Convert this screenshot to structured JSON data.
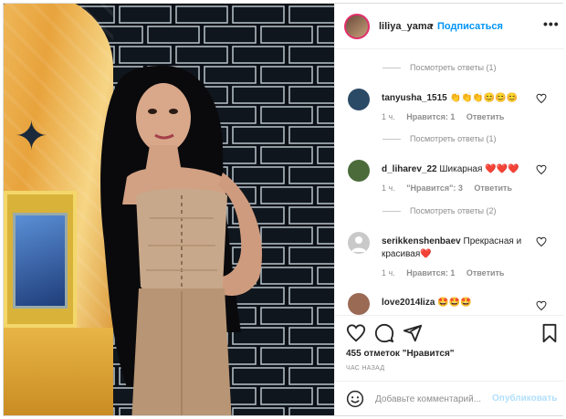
{
  "post": {
    "username": "liliya_yama",
    "separator": "•",
    "follow_label": "Подписаться",
    "more_label": "•••"
  },
  "comments": {
    "view_replies": [
      "Посмотреть ответы (1)",
      "Посмотреть ответы (1)",
      "Посмотреть ответы (2)"
    ],
    "items": [
      {
        "username": "tanyusha_1515",
        "text": "👏👏👏😊😊😊",
        "time": "1 ч.",
        "likes_label": "Нравится: 1",
        "reply_label": "Ответить",
        "avatar_color": "#2b4a66"
      },
      {
        "username": "d_liharev_22",
        "text": "Шикарная ❤️❤️❤️",
        "time": "1 ч.",
        "likes_label": "\"Нравится\": 3",
        "reply_label": "Ответить",
        "avatar_color": "#4b6b3a"
      },
      {
        "username": "serikkenshenbaev",
        "text": "Прекрасная и красивая❤️",
        "time": "1 ч.",
        "likes_label": "Нравится: 1",
        "reply_label": "Ответить",
        "avatar_color": "#c9c9c9"
      },
      {
        "username": "love2014liza",
        "text": "🤩🤩🤩",
        "avatar_color": "#9a6a55"
      }
    ]
  },
  "actions": {
    "likes_text": "455 отметок \"Нравится\"",
    "time_ago": "ЧАС НАЗАД"
  },
  "add_comment": {
    "placeholder": "Добавьте комментарий...",
    "publish_label": "Опубликовать"
  },
  "colors": {
    "accent": "#0095f6",
    "publish_disabled": "#b2dffc",
    "muted": "#8e8e8e",
    "text": "#262626",
    "like_red": "#ed4956"
  }
}
